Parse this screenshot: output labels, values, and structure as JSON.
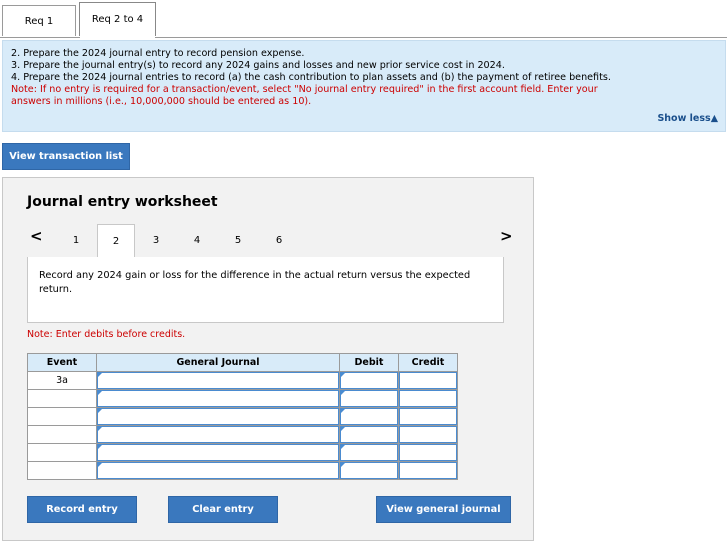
{
  "tabs": [
    {
      "label": "Req 1"
    },
    {
      "label": "Req 2 to 4"
    }
  ],
  "instructions": {
    "lines": [
      "2. Prepare the 2024 journal entry to record pension expense.",
      "3. Prepare the journal entry(s) to record any 2024 gains and losses and new prior service cost in 2024.",
      "4. Prepare the 2024 journal entries to record (a) the cash contribution to plan assets and (b) the payment of retiree benefits."
    ],
    "note_line1": "Note: If no entry is required for a transaction/event, select \"No journal entry required\" in the first account field. Enter your",
    "note_line2": "answers in millions (i.e., 10,000,000 should be entered as 10).",
    "show_less": "Show less"
  },
  "buttons": {
    "view_transaction_list": "View transaction list",
    "record_entry": "Record entry",
    "clear_entry": "Clear entry",
    "view_general_journal": "View general journal"
  },
  "worksheet": {
    "title": "Journal entry worksheet",
    "pages": [
      "1",
      "2",
      "3",
      "4",
      "5",
      "6"
    ],
    "active_page": "2",
    "description": "Record any 2024 gain or loss for the difference in the actual return versus the expected return.",
    "note": "Note: Enter debits before credits.",
    "columns": {
      "event": "Event",
      "general_journal": "General Journal",
      "debit": "Debit",
      "credit": "Credit"
    },
    "rows": [
      {
        "event": "3a"
      },
      {
        "event": ""
      },
      {
        "event": ""
      },
      {
        "event": ""
      },
      {
        "event": ""
      },
      {
        "event": ""
      }
    ]
  },
  "icons": {
    "prev": "chevron-left-icon",
    "next": "chevron-right-icon",
    "show_less_arrow": "triangle-up-icon"
  }
}
